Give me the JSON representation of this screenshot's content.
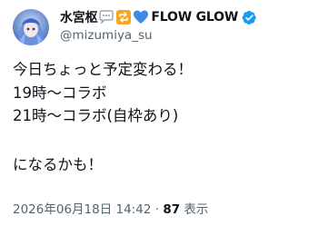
{
  "author": {
    "display_name": "水宮枢",
    "name_suffix": "FLOW GLOW",
    "handle": "@mizumiya_su",
    "emojis": [
      "speech-bubble-emoji",
      "repeat-emoji",
      "blue-heart-emoji"
    ],
    "verified": true
  },
  "post": {
    "lines": [
      "今日ちょっと予定変わる！",
      "19時〜コラボ",
      "21時〜コラボ(自枠あり)",
      "",
      "になるかも！"
    ]
  },
  "meta": {
    "timestamp": "2026年06月18日 14:42",
    "separator": "·",
    "views_count": "87",
    "views_label": "表示"
  },
  "colors": {
    "text": "#0f1419",
    "secondary": "#536471",
    "verified": "#1d9bf0",
    "heart": "#3c8ce7",
    "repeat": "#f5a623"
  }
}
